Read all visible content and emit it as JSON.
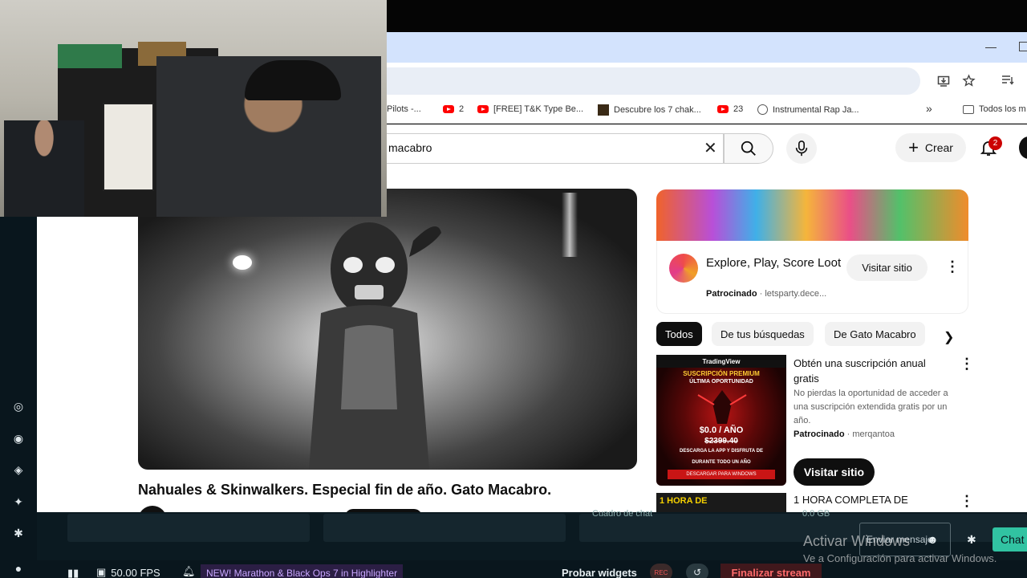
{
  "window": {
    "minimize": "—"
  },
  "bookmarks": [
    {
      "label": "Pilots -...",
      "icon": "none"
    },
    {
      "label": "2",
      "icon": "youtube-icon"
    },
    {
      "label": "[FREE] T&K Type Be...",
      "icon": "youtube-icon"
    },
    {
      "label": "Descubre los 7 chak...",
      "icon": "site-icon"
    },
    {
      "label": "23",
      "icon": "youtube-icon"
    },
    {
      "label": "Instrumental Rap Ja...",
      "icon": "globe-icon"
    },
    {
      "label": "»",
      "icon": "none"
    },
    {
      "label": "Todos los m",
      "icon": "folder-icon"
    }
  ],
  "youtube": {
    "search_value": "macabro",
    "create_label": "Crear",
    "notification_count": "2",
    "video_title": "Nahuales & Skinwalkers. Especial fin de año. Gato Macabro.",
    "ad": {
      "title": "Explore, Play, Score Loot",
      "sponsored": "Patrocinado",
      "domain": "letsparty.dece...",
      "button": "Visitar sitio"
    },
    "chips": [
      "Todos",
      "De tus búsquedas",
      "De Gato Macabro"
    ],
    "promo": {
      "brand": "TradingView",
      "thumb_lines": [
        "SUSCRIPCIÓN PREMIUM",
        "ÚLTIMA OPORTUNIDAD",
        "$0.0 / AÑO",
        "$2399.40",
        "DESCARGA LA APP Y DISFRUTA DE",
        "DURANTE TODO UN AÑO",
        "DESCARGAR PARA WINDOWS"
      ],
      "title": "Obtén una suscripción anual gratis",
      "description": "No pierdas la oportunidad de acceder a una suscripción extendida gratis por un año.",
      "sponsored": "Patrocinado",
      "advertiser": "merqantoa",
      "button": "Visitar sitio"
    },
    "next_thumb": "1 HORA DE",
    "next_title": "1 HORA COMPLETA DE"
  },
  "stream": {
    "fps": "50.00 FPS",
    "news": "NEW! Marathon & Black Ops 7 in Highlighter",
    "try_widgets": "Probar widgets",
    "rec": "REC",
    "end_stream": "Finalizar stream",
    "chat_box_label": "Cuadro de chat",
    "chat_count": "0.0 GB",
    "send_message": "Enviar mensaje",
    "chat_button": "Chat"
  },
  "watermark": {
    "line1": "Activar Windows",
    "line2": "Ve a Configuración para activar Windows."
  },
  "colors": {
    "chrome_title": "#d3e3fd",
    "youtube_red": "#ff0000",
    "stream_bg": "#09161d",
    "chat_green": "#31c3a2",
    "end_red": "#ff6b6b"
  }
}
